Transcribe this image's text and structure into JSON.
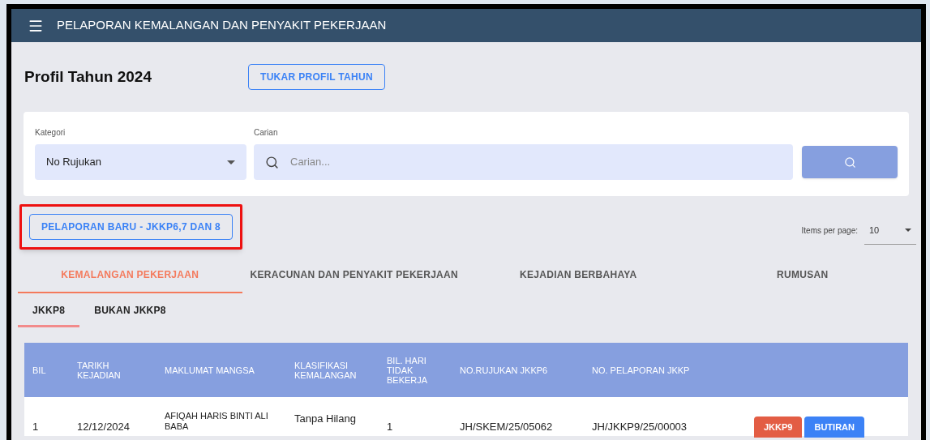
{
  "app_bar": {
    "title": "PELAPORAN KEMALANGAN DAN PENYAKIT PEKERJAAN"
  },
  "profile": {
    "title": "Profil Tahun 2024",
    "change_button": "TUKAR PROFIL TAHUN"
  },
  "search": {
    "category_label": "Kategori",
    "category_value": "No Rujukan",
    "search_label": "Carian",
    "placeholder": "Carian..."
  },
  "new_report_button": {
    "label": "PELAPORAN BARU - JKKP6,7 DAN 8",
    "highlighted": true
  },
  "pagination": {
    "label": "Items per page:",
    "value": "10"
  },
  "tabs": [
    {
      "label": "KEMALANGAN PEKERJAAN",
      "selected": true
    },
    {
      "label": "KERACUNAN DAN PENYAKIT PEKERJAAN",
      "selected": false
    },
    {
      "label": "KEJADIAN BERBAHAYA",
      "selected": false
    },
    {
      "label": "RUMUSAN",
      "selected": false
    }
  ],
  "subtabs": [
    {
      "label": "JKKP8",
      "selected": true
    },
    {
      "label": "BUKAN JKKP8",
      "selected": false
    }
  ],
  "table": {
    "columns": [
      "BIL",
      "TARIKH KEJADIAN",
      "MAKLUMAT MANGSA",
      "KLASIFIKASI KEMALANGAN",
      "BIL. HARI TIDAK BEKERJA",
      "NO.RUJUKAN JKKP6",
      "NO. PELAPORAN JKKP"
    ],
    "rows": [
      {
        "cells": [
          "1",
          "12/12/2024",
          "AFIQAH HARIS BINTI ALI BABA",
          "Tanpa Hilang",
          "1",
          "JH/SKEM/25/05062",
          "JH/JKKP9/25/00003"
        ],
        "actions": [
          "JKKP9",
          "BUTIRAN"
        ]
      }
    ]
  }
}
